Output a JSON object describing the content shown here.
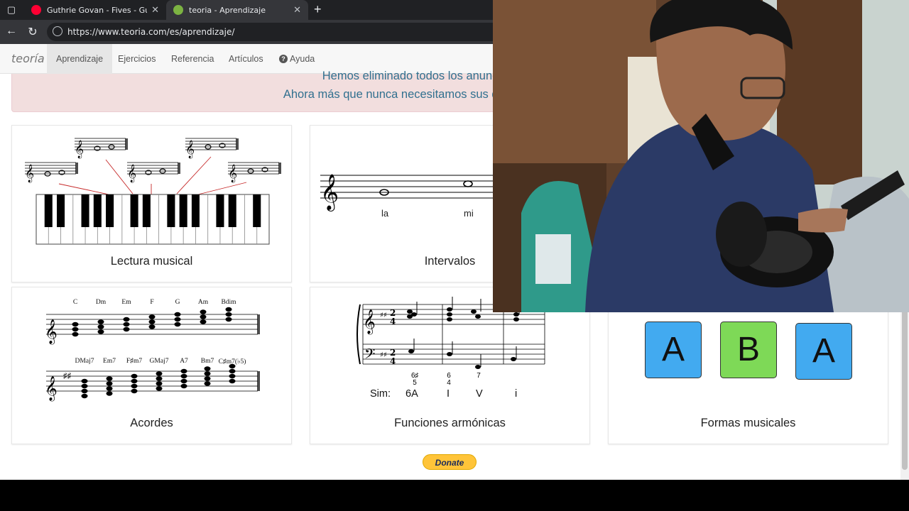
{
  "browser": {
    "tabs": [
      {
        "title": "Guthrie Govan - Fives - Guitar per",
        "favicon_color": "#ff0033"
      },
      {
        "title": "teoria - Aprendizaje",
        "favicon_color": "#7cb342"
      }
    ],
    "url": "https://www.teoria.com/es/aprendizaje/"
  },
  "site": {
    "brand": "teoría",
    "nav": [
      "Aprendizaje",
      "Ejercicios",
      "Referencia",
      "Artículos",
      "Ayuda"
    ]
  },
  "alert": {
    "line1": "Hemos eliminado todos los anuncios publicitarios",
    "line2": "Ahora más que nunca necesitamos sus donaciones. ¡Ayúdenos!"
  },
  "cards": {
    "lectura": {
      "caption": "Lectura musical"
    },
    "intervalos": {
      "caption": "Intervalos",
      "note1": "la",
      "note2": "mi"
    },
    "acordes": {
      "caption": "Acordes",
      "row1": [
        "C",
        "Dm",
        "Em",
        "F",
        "G",
        "Am",
        "Bdim"
      ],
      "row2": [
        "DMaj7",
        "Em7",
        "F♯m7",
        "GMaj7",
        "A7",
        "Bm7",
        "C♯m7(♭5)"
      ]
    },
    "funciones": {
      "caption": "Funciones armónicas",
      "figures": [
        "6♯ 5",
        "6 4",
        "7"
      ],
      "sim_label": "Sim:",
      "numerals": [
        "6A",
        "I",
        "V",
        "i"
      ]
    },
    "formas": {
      "caption": "Formas musicales",
      "boxes": [
        "A",
        "B",
        "A"
      ],
      "colors": [
        "#42aaf0",
        "#7ed957",
        "#42aaf0"
      ]
    }
  },
  "donate": {
    "label": "Donate"
  }
}
